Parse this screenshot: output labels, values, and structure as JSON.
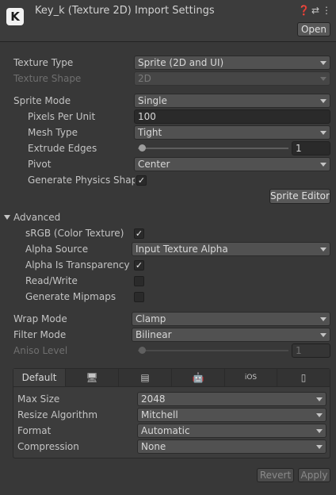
{
  "header": {
    "asset_letter": "K",
    "title": "Key_k (Texture 2D) Import Settings",
    "icons": [
      "help-icon",
      "preset-icon",
      "kebab-menu-icon"
    ],
    "help_glyph": "❓",
    "preset_glyph": "⇄",
    "menu_glyph": "⋮",
    "open_label": "Open"
  },
  "texture": {
    "type_label": "Texture Type",
    "type_value": "Sprite (2D and UI)",
    "shape_label": "Texture Shape",
    "shape_value": "2D"
  },
  "sprite": {
    "mode_label": "Sprite Mode",
    "mode_value": "Single",
    "ppu_label": "Pixels Per Unit",
    "ppu_value": "100",
    "mesh_label": "Mesh Type",
    "mesh_value": "Tight",
    "extrude_label": "Extrude Edges",
    "extrude_value": "1",
    "extrude_fraction": 0.03,
    "pivot_label": "Pivot",
    "pivot_value": "Center",
    "physics_label": "Generate Physics Shape",
    "physics_checked": true,
    "editor_button": "Sprite Editor"
  },
  "advanced": {
    "section_label": "Advanced",
    "srgb_label": "sRGB (Color Texture)",
    "srgb_checked": true,
    "alpha_source_label": "Alpha Source",
    "alpha_source_value": "Input Texture Alpha",
    "alpha_transp_label": "Alpha Is Transparency",
    "alpha_transp_checked": true,
    "readwrite_label": "Read/Write",
    "readwrite_checked": false,
    "mipmaps_label": "Generate Mipmaps",
    "mipmaps_checked": false
  },
  "sampling": {
    "wrap_label": "Wrap Mode",
    "wrap_value": "Clamp",
    "filter_label": "Filter Mode",
    "filter_value": "Bilinear",
    "aniso_label": "Aniso Level",
    "aniso_value": "1",
    "aniso_fraction": 0.03
  },
  "platform_tabs": {
    "default_label": "Default",
    "ios_label": "iOS",
    "icons": [
      "monitor-icon",
      "server-icon",
      "android-icon",
      "ios-tab",
      "switch-icon"
    ],
    "monitor_glyph": "🖥",
    "server_glyph": "▤",
    "android_glyph": "🤖",
    "switch_glyph": "▯"
  },
  "platform_settings": {
    "maxsize_label": "Max Size",
    "maxsize_value": "2048",
    "resize_label": "Resize Algorithm",
    "resize_value": "Mitchell",
    "format_label": "Format",
    "format_value": "Automatic",
    "compression_label": "Compression",
    "compression_value": "None"
  },
  "footer": {
    "revert_label": "Revert",
    "apply_label": "Apply"
  },
  "check_glyph": "✓",
  "colors": {
    "background": "#383838",
    "field": "#2a2a2a",
    "dropdown": "#515151",
    "text": "#c4c4c4",
    "disabled_text": "#6f6f6f"
  }
}
